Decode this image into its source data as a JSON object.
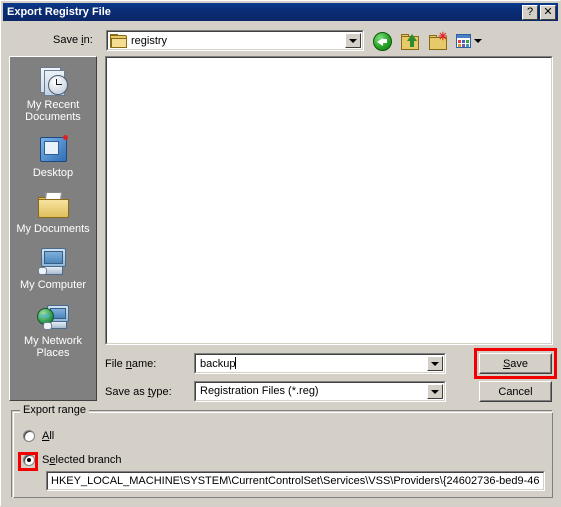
{
  "window": {
    "title": "Export Registry File",
    "help_button": "?",
    "close_button": "✕"
  },
  "toolbar": {
    "save_in_label_pre": "Save ",
    "save_in_label_mnemonic": "i",
    "save_in_label_post": "n:",
    "save_in_label": "Save in:",
    "current_folder": "registry",
    "folder_icon": "folder-icon",
    "buttons": [
      {
        "name": "back-button",
        "icon": "back-arrow-icon",
        "tooltip": "Back"
      },
      {
        "name": "up-one-level-button",
        "icon": "up-folder-icon",
        "tooltip": "Up One Level"
      },
      {
        "name": "create-new-folder-button",
        "icon": "new-folder-icon",
        "tooltip": "Create New Folder"
      },
      {
        "name": "views-button",
        "icon": "views-icon",
        "tooltip": "Views"
      }
    ]
  },
  "places_bar": {
    "items": [
      {
        "label": "My Recent Documents",
        "icon": "recent-documents-icon"
      },
      {
        "label": "Desktop",
        "icon": "desktop-icon"
      },
      {
        "label": "My Documents",
        "icon": "my-documents-icon"
      },
      {
        "label": "My Computer",
        "icon": "my-computer-icon"
      },
      {
        "label": "My Network Places",
        "icon": "my-network-places-icon"
      }
    ]
  },
  "file_list": {
    "items": [],
    "empty": true
  },
  "fields": {
    "file_name_label": "File name:",
    "file_name_value": "backup",
    "save_as_type_label": "Save as type:",
    "save_as_type_value": "Registration Files (*.reg)",
    "save_as_type_options": [
      "Registration Files (*.reg)"
    ]
  },
  "buttons": {
    "save_label": "Save",
    "cancel_label": "Cancel"
  },
  "export_range": {
    "legend": "Export range",
    "options": [
      {
        "label": "All",
        "selected": false
      },
      {
        "label": "Selected branch",
        "selected": true
      }
    ],
    "selected_branch_path": "HKEY_LOCAL_MACHINE\\SYSTEM\\CurrentControlSet\\Services\\VSS\\Providers\\{24602736-bed9-46"
  },
  "highlights": {
    "save_button": {
      "color": "#f20000",
      "target": "save-button"
    },
    "selected_branch_radio": {
      "color": "#f20000",
      "target": "radio-selected-branch"
    }
  },
  "colors": {
    "titlebar": "#0a2d75",
    "dialog_face": "#d4d0c8",
    "places_bar": "#808080",
    "highlight_red": "#f20000",
    "field_white": "#ffffff"
  }
}
